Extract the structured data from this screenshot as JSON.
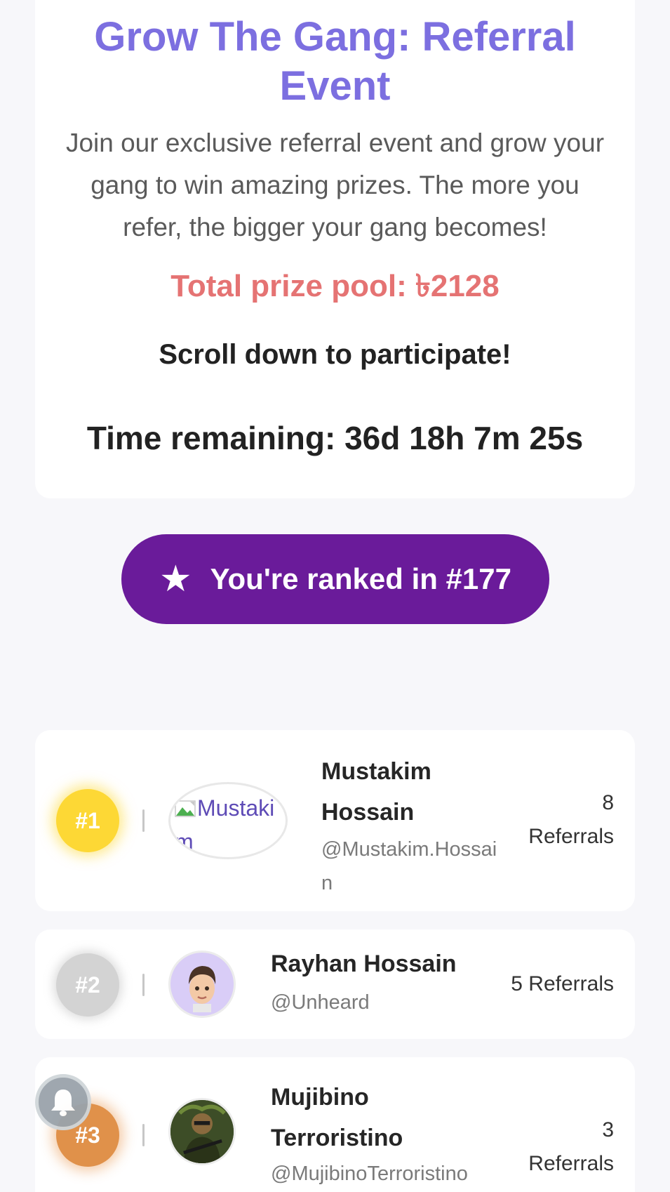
{
  "event": {
    "title": "Grow The Gang: Referral Event",
    "description": "Join our exclusive referral event and grow your gang to win amazing prizes. The more you refer, the bigger your gang becomes!",
    "prize_pool": "Total prize pool: ৳2128",
    "scroll_hint": "Scroll down to participate!",
    "time_remaining": "Time remaining: 36d 18h 7m 25s"
  },
  "rank_button": {
    "icon": "star-icon",
    "label": "You're ranked in #177"
  },
  "leaderboard": [
    {
      "rank": "#1",
      "name": "Mustakim Hossain",
      "handle": "@Mustakim.Hossain",
      "referrals": "8 Referrals",
      "avatar_alt": "Mustakim",
      "badge_color": "#fdd835"
    },
    {
      "rank": "#2",
      "name": "Rayhan Hossain",
      "handle": "@Unheard",
      "referrals": "5 Referrals",
      "badge_color": "#d3d3d3"
    },
    {
      "rank": "#3",
      "name": "Mujibino Terroristino",
      "handle": "@MujibinoTerroristino",
      "referrals": "3 Referrals",
      "badge_color": "#e0914a"
    }
  ],
  "notification_fab": {
    "icon": "bell-icon"
  },
  "colors": {
    "title": "#7c6fe0",
    "prize": "#e57373",
    "rank_button": "#6a1b9a",
    "background": "#f7f7fa"
  }
}
